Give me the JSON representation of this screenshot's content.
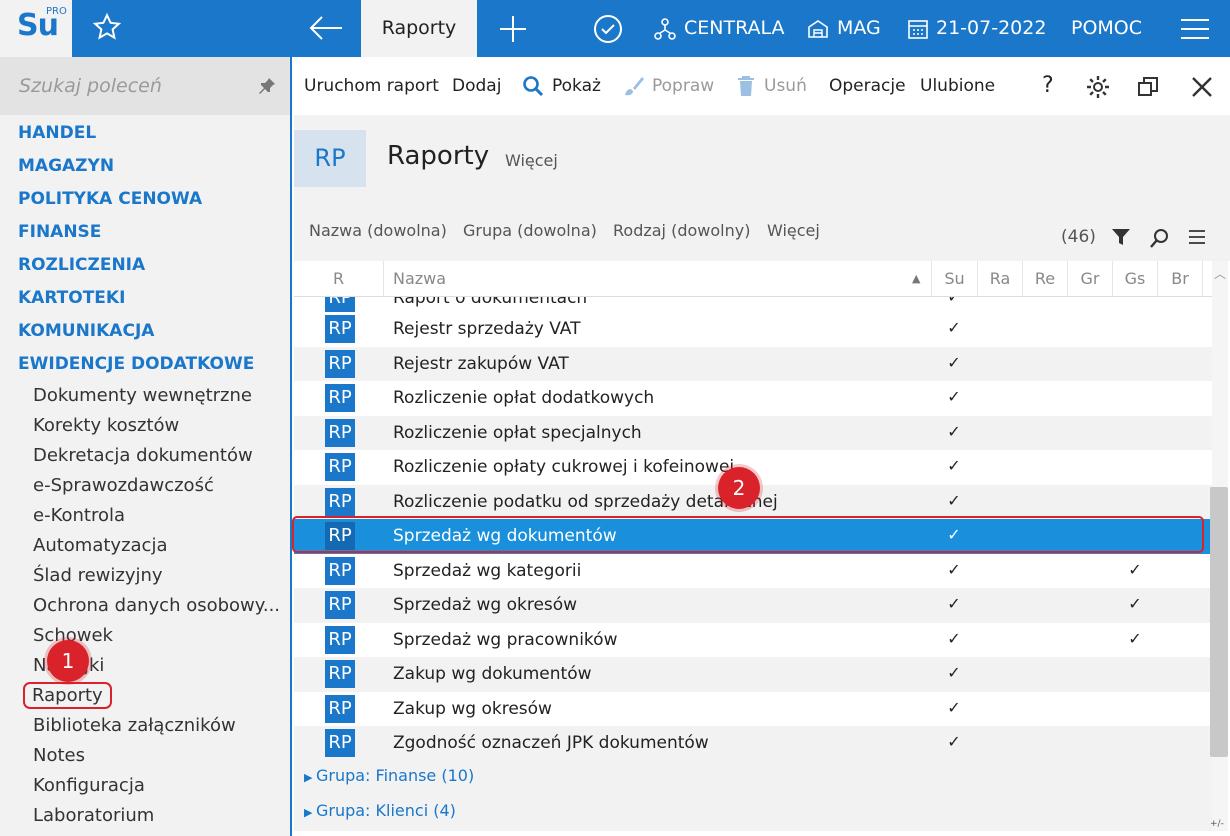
{
  "topbar": {
    "logo": "Su",
    "logo_sup": "PRO",
    "active_tab": "Raporty",
    "centrala": "CENTRALA",
    "mag": "MAG",
    "date": "21-07-2022",
    "help": "POMOC",
    "accent": "#1a77c9"
  },
  "sidebar": {
    "search_placeholder": "Szukaj poleceń",
    "categories": [
      "HANDEL",
      "MAGAZYN",
      "POLITYKA CENOWA",
      "FINANSE",
      "ROZLICZENIA",
      "KARTOTEKI",
      "KOMUNIKACJA",
      "EWIDENCJE DODATKOWE"
    ],
    "subitems": [
      "Dokumenty wewnętrzne",
      "Korekty kosztów",
      "Dekretacja dokumentów",
      "e-Sprawozdawczość",
      "e-Kontrola",
      "Automatyzacja",
      "Ślad rewizyjny",
      "Ochrona danych osobowy...",
      "Schowek",
      "Naklejki",
      "Raporty",
      "Biblioteka załączników",
      "Notes",
      "Konfiguracja",
      "Laboratorium"
    ]
  },
  "toolbar": {
    "run": "Uruchom raport",
    "add": "Dodaj",
    "show": "Pokaż",
    "edit": "Popraw",
    "delete": "Usuń",
    "operations": "Operacje",
    "favorites": "Ulubione",
    "help": "?"
  },
  "header": {
    "badge": "RP",
    "title": "Raporty",
    "more": "Więcej"
  },
  "filters": {
    "name": "Nazwa (dowolna)",
    "group": "Grupa (dowolna)",
    "kind": "Rodzaj (dowolny)",
    "more": "Więcej",
    "count": "(46)"
  },
  "columns": [
    "R",
    "Nazwa",
    "Su",
    "Ra",
    "Re",
    "Gr",
    "Gs",
    "Br"
  ],
  "rows": [
    {
      "icon": "RP",
      "name": "Raport o dokumentach",
      "su": "✓",
      "gs": ""
    },
    {
      "icon": "RP",
      "name": "Rejestr sprzedaży VAT",
      "su": "✓",
      "gs": ""
    },
    {
      "icon": "RP",
      "name": "Rejestr zakupów VAT",
      "su": "✓",
      "gs": ""
    },
    {
      "icon": "RP",
      "name": "Rozliczenie opłat dodatkowych",
      "su": "✓",
      "gs": ""
    },
    {
      "icon": "RP",
      "name": "Rozliczenie opłat specjalnych",
      "su": "✓",
      "gs": ""
    },
    {
      "icon": "RP",
      "name": "Rozliczenie opłaty cukrowej i kofeinowej",
      "su": "✓",
      "gs": ""
    },
    {
      "icon": "RP",
      "name": "Rozliczenie podatku od sprzedaży detalicznej",
      "su": "✓",
      "gs": ""
    },
    {
      "icon": "RP",
      "name": "Sprzedaż wg dokumentów",
      "su": "✓",
      "gs": ""
    },
    {
      "icon": "RP",
      "name": "Sprzedaż wg kategorii",
      "su": "✓",
      "gs": "✓"
    },
    {
      "icon": "RP",
      "name": "Sprzedaż wg okresów",
      "su": "✓",
      "gs": "✓"
    },
    {
      "icon": "RP",
      "name": "Sprzedaż wg pracowników",
      "su": "✓",
      "gs": "✓"
    },
    {
      "icon": "RP",
      "name": "Zakup wg dokumentów",
      "su": "✓",
      "gs": ""
    },
    {
      "icon": "RP",
      "name": "Zakup wg okresów",
      "su": "✓",
      "gs": ""
    },
    {
      "icon": "RP",
      "name": "Zgodność oznaczeń JPK dokumentów",
      "su": "✓",
      "gs": ""
    }
  ],
  "groups": [
    "Grupa: Finanse (10)",
    "Grupa: Klienci (4)"
  ],
  "annotations": {
    "badge1": "1",
    "badge2": "2",
    "color": "#d9222a"
  },
  "footer": "+/-"
}
